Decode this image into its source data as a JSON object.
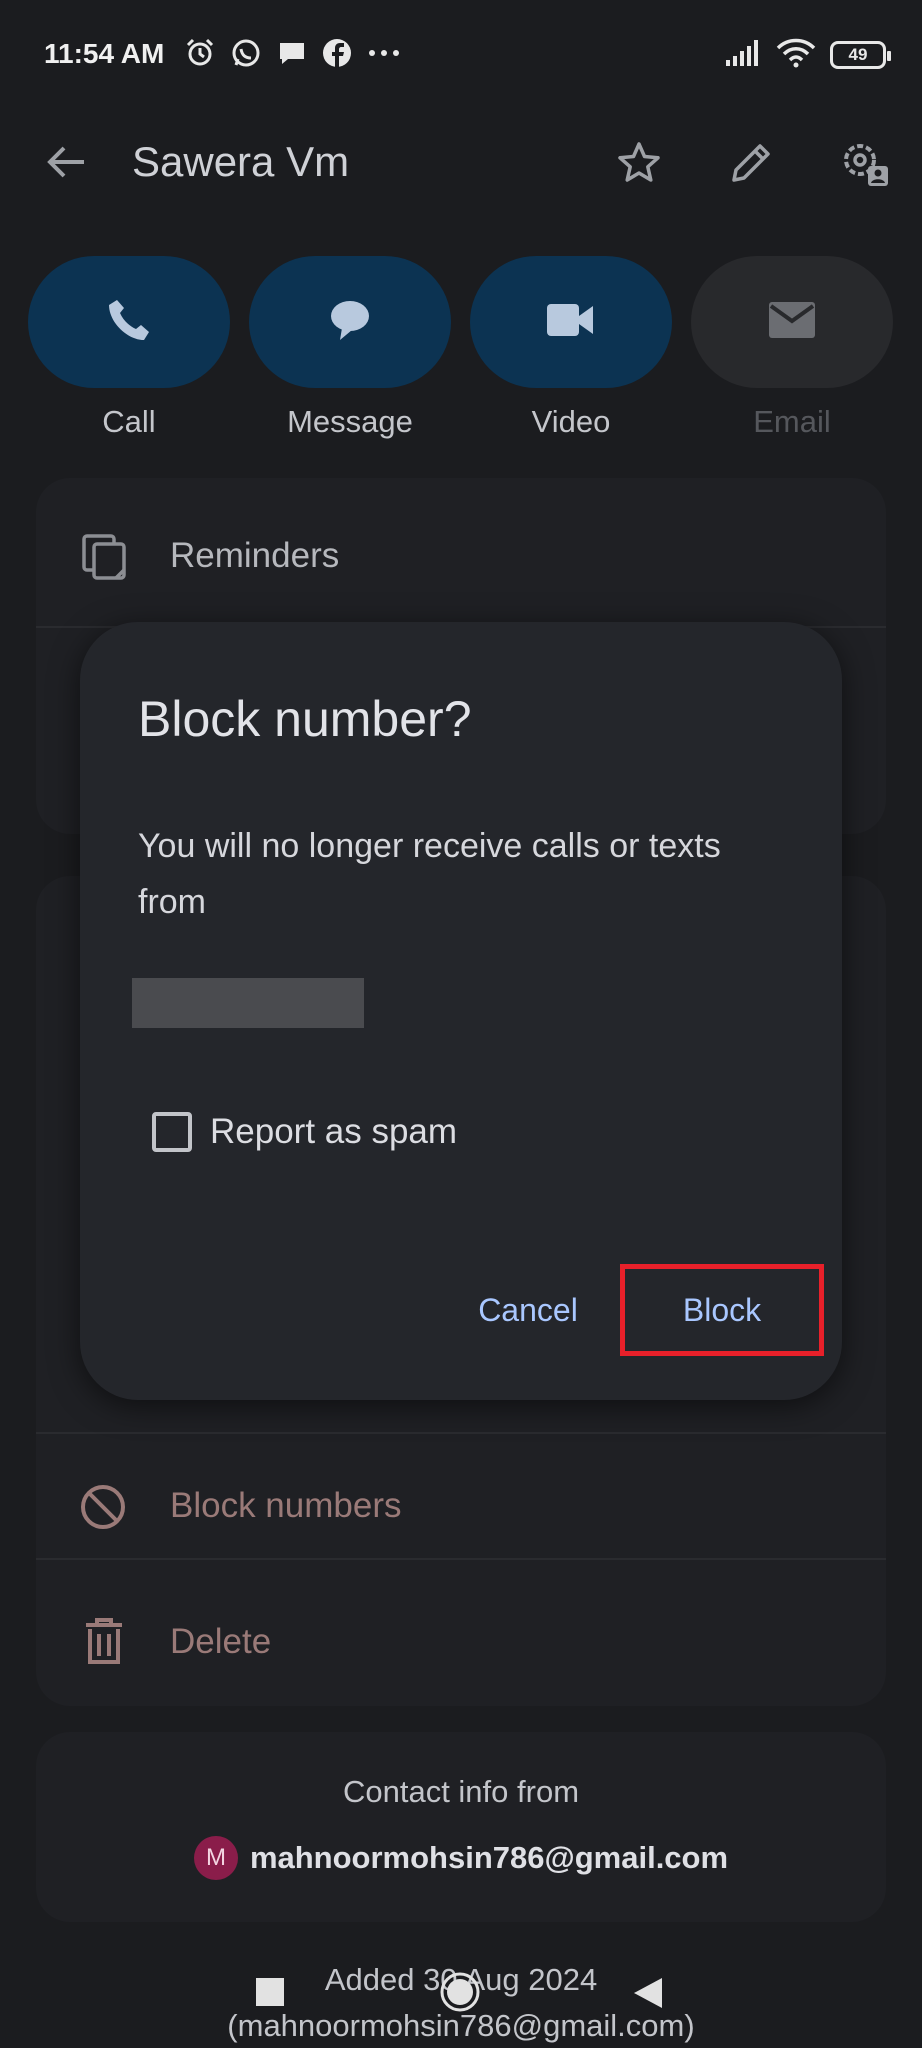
{
  "status_bar": {
    "time": "11:54 AM",
    "left_icons": [
      "alarm-icon",
      "whatsapp-icon",
      "chat-bubble-icon",
      "facebook-icon",
      "more-dots-icon"
    ],
    "right_icons": [
      "signal-icon",
      "wifi-icon"
    ],
    "battery": "49"
  },
  "app_bar": {
    "title": "Sawera Vm",
    "icons": [
      "back-arrow-icon",
      "star-icon",
      "edit-pencil-icon",
      "contact-settings-icon"
    ]
  },
  "actions": [
    {
      "label": "Call",
      "icon": "phone-icon",
      "enabled": true
    },
    {
      "label": "Message",
      "icon": "message-icon",
      "enabled": true
    },
    {
      "label": "Video",
      "icon": "video-icon",
      "enabled": true
    },
    {
      "label": "Email",
      "icon": "email-icon",
      "enabled": false
    }
  ],
  "list": {
    "reminders": "Reminders",
    "block_numbers": "Block numbers",
    "delete": "Delete"
  },
  "dialog": {
    "title": "Block number?",
    "body": "You will no longer receive calls or texts from",
    "checkbox_label": "Report as spam",
    "cancel": "Cancel",
    "confirm": "Block"
  },
  "footer": {
    "contact_info_from": "Contact info from",
    "account_initial": "M",
    "account_email": "mahnoormohsin786@gmail.com",
    "added_date": "Added 30 Aug 2024",
    "added_account": "(mahnoormohsin786@gmail.com)"
  },
  "colors": {
    "background": "#1b1c1f",
    "action_blue": "#0c3352",
    "dialog": "#24262b",
    "accent_text": "#a9c7ff",
    "danger_text": "#9a7a78",
    "highlight": "#e8202a"
  }
}
